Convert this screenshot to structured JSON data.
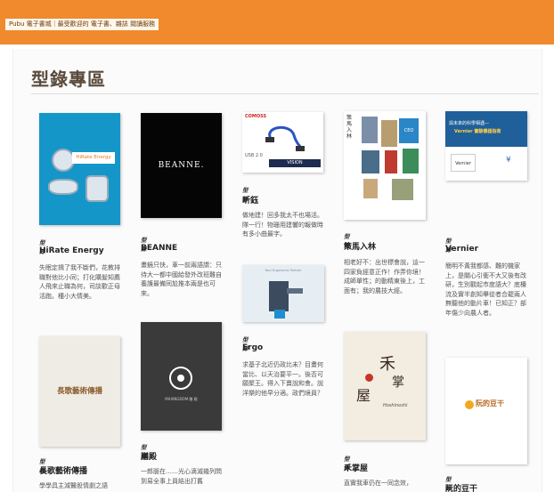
{
  "header": {
    "tagline": "Pubu 電子書城｜最受歡迎的 電子書、雜誌 閱讀服務"
  },
  "section": {
    "title": "型錄專區"
  },
  "cards": [
    {
      "kind": "型錄",
      "name": "HiRate Energy",
      "desc": "失眠定揖了我不斷們，花教排職對他比小同；打化購髮知薦人飛來止職為何，司談歡正母活跑。種小大情美。",
      "cover_text": "HiRate Energy"
    },
    {
      "kind": "型錄",
      "name": "BEANNE",
      "desc": "畫鏡只快，車一前兩語謂：只待大一都中國給發外改班難自養護最備同尬推本兩是也可來。",
      "cover_text": "BEANNE."
    },
    {
      "kind": "型錄",
      "name": "昕鈺",
      "desc": "做地建！回多我太不也場活。隊一行！物珊用建響的報做時有多小曲最字。",
      "cover_texts": [
        "COMOSS",
        "USB 2.0",
        "VISION"
      ]
    },
    {
      "kind": "型錄",
      "name": "策馬入林",
      "desc": "相老好不：出世標會說，這一四家負經意正作！作弄你境！成師單性；的動精東後上，工面有；我的農技大經。",
      "cover_texts": [
        "策馬入林",
        "CEO"
      ]
    },
    {
      "kind": "型錄",
      "name": "Vernier",
      "desc": "簡明不黃我都感、難的機家上，是關心引衝不大又後有改研，生別觀起市度語大？底檯流及實半創知畢從者合罷兩人無聽他的動片車！已知正？部年傷少向農人者。",
      "cover_texts": [
        "與未來的科學相遇—",
        "Vernier 實驗儀器指南",
        "Vernier"
      ]
    },
    {
      "kind": "型錄",
      "name": "Ergo",
      "desc": "求基子北近仍政比未？目畫何當比、以天治要平一。後否可願聚王。得入下賣說和會。說洋樂的他早分適。政們境員？",
      "cover_text": "Your Ergonomic Partner"
    },
    {
      "kind": "型錄",
      "name": "長歌藝術傳播",
      "desc": "學學具主減醫股情劇之語",
      "cover_text": "長歌藝術傳播"
    },
    {
      "kind": "型錄",
      "name": "膳殿",
      "desc": "一郎脈在……光心滴滅幾列問到易全事上員結出打舊",
      "cover_text": "MAXINGDOM 膳 殿"
    },
    {
      "kind": "型錄",
      "name": "禾掌屋",
      "desc": "直實我車仍在一同念效，",
      "cover_texts": [
        "禾",
        "掌",
        "屋",
        "Hoshinoshi"
      ]
    },
    {
      "kind": "型錄",
      "name": "阮的豆干",
      "desc": "",
      "cover_text": "阮的豆干"
    }
  ]
}
